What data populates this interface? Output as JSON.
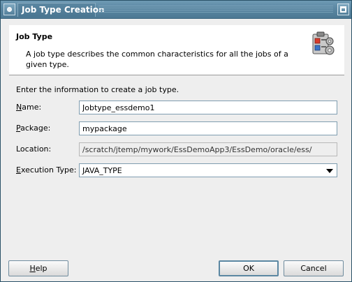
{
  "window": {
    "title": "Job Type Creation"
  },
  "header": {
    "title": "Job Type",
    "description": "A job type describes the common characteristics for all the jobs of a given type."
  },
  "form": {
    "intro": "Enter the information to create a job type.",
    "name": {
      "label": "Name:",
      "mnemonic": "N",
      "label_rest": "ame:",
      "value": "Jobtype_essdemo1"
    },
    "package": {
      "label": "Package:",
      "mnemonic": "P",
      "label_rest": "ackage:",
      "value": "mypackage"
    },
    "location": {
      "label": "Location:",
      "value": "/scratch/jtemp/mywork/EssDemoApp3/EssDemo/oracle/ess/"
    },
    "execution_type": {
      "label": "Execution Type:",
      "mnemonic": "E",
      "label_rest": "xecution Type:",
      "value": "JAVA_TYPE"
    }
  },
  "buttons": {
    "help": {
      "label": "Help",
      "mnemonic": "H",
      "label_rest": "elp"
    },
    "ok": {
      "label": "OK"
    },
    "cancel": {
      "label": "Cancel"
    }
  },
  "icons": {
    "window_menu": "window-menu-icon",
    "maximize": "maximize-icon",
    "header": "job-type-clipboard-icon",
    "dropdown": "chevron-down-icon"
  },
  "colors": {
    "titlebar": "#5b87a2",
    "dialog_bg": "#eeeeee",
    "header_bg": "#ffffff"
  }
}
